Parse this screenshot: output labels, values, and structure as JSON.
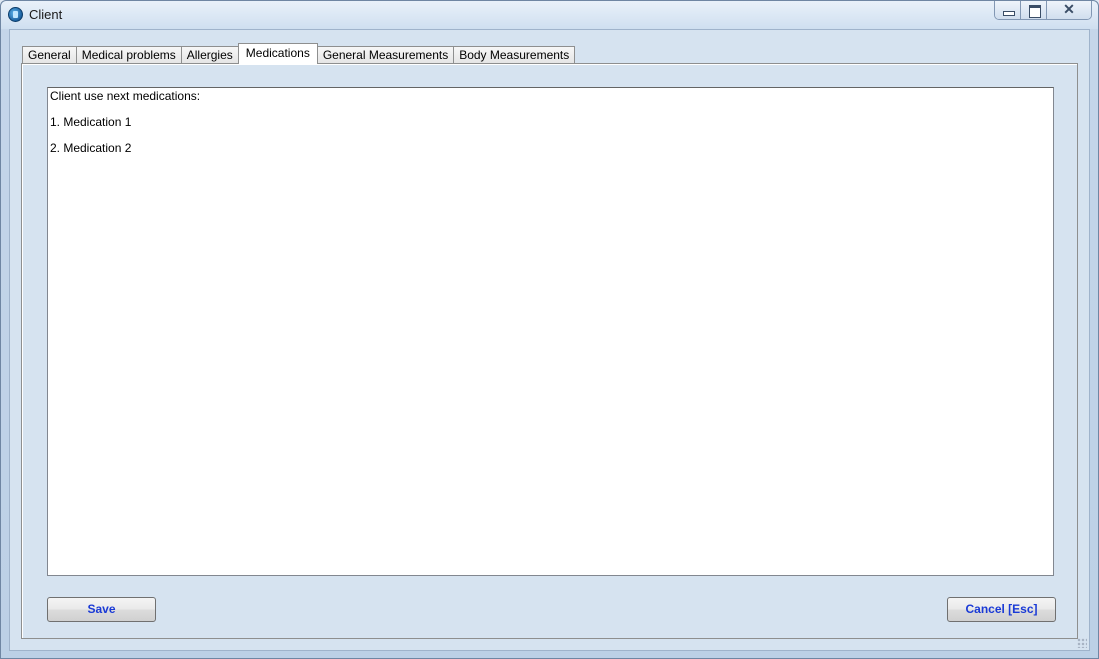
{
  "window": {
    "title": "Client",
    "close_label": "✕"
  },
  "tabs": [
    {
      "label": "General",
      "active": false
    },
    {
      "label": "Medical problems",
      "active": false
    },
    {
      "label": "Allergies",
      "active": false
    },
    {
      "label": "Medications",
      "active": true
    },
    {
      "label": "General Measurements",
      "active": false
    },
    {
      "label": "Body Measurements",
      "active": false
    }
  ],
  "medications": {
    "text": "Client use next medications:\n\n1. Medication 1\n\n2. Medication 2"
  },
  "buttons": {
    "save_label": "Save",
    "cancel_label": "Cancel [Esc]"
  },
  "colors": {
    "button_text": "#1a3ad6",
    "panel_bg": "#d6e3f0"
  }
}
